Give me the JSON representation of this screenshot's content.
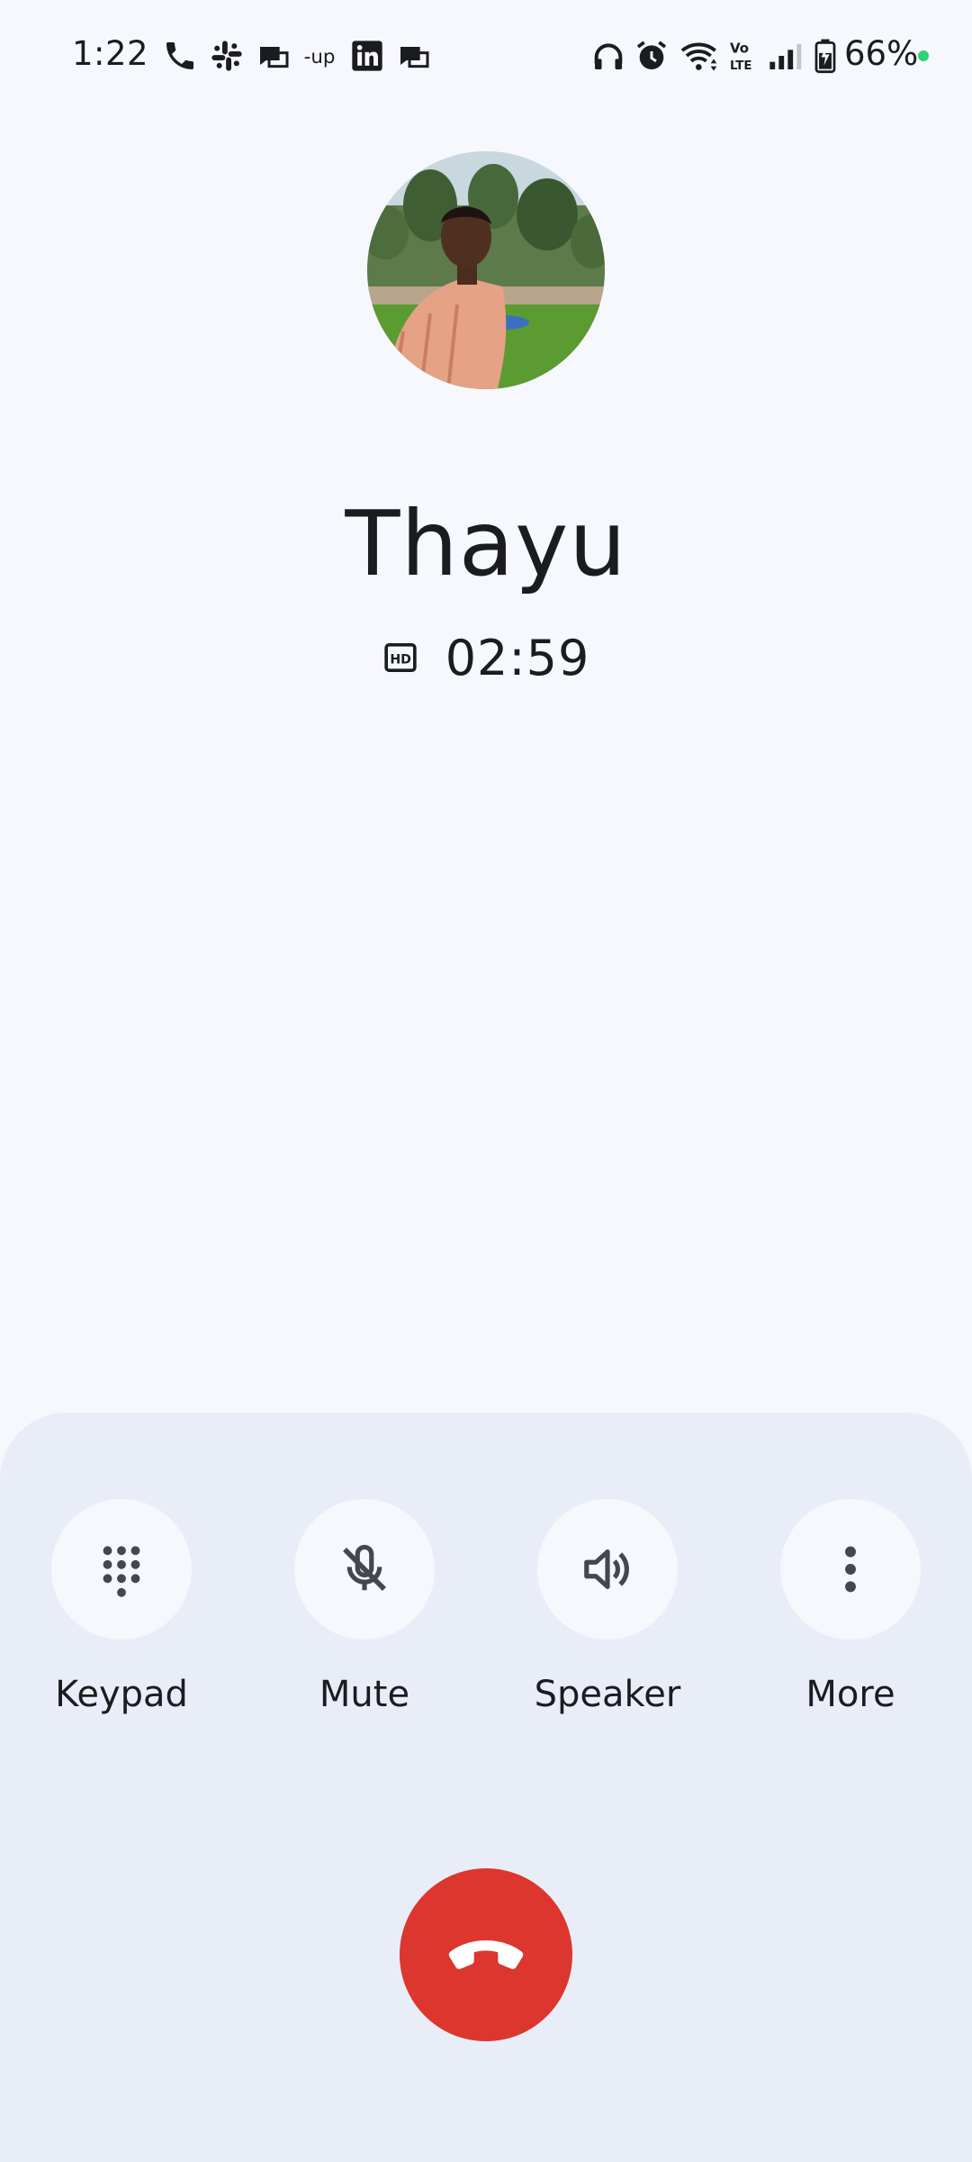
{
  "status_bar": {
    "time": "1:22",
    "battery_percent": "66%",
    "notification_icons": [
      "phone-icon",
      "slack-icon",
      "message-icon",
      "upwork-icon",
      "linkedin-icon",
      "message-icon"
    ],
    "system_icons": [
      "headphones-icon",
      "alarm-icon",
      "wifi-icon",
      "volte-icon",
      "signal-icon",
      "battery-charging-icon"
    ]
  },
  "call": {
    "contact_name": "Thayu",
    "duration": "02:59",
    "hd_badge": "HD"
  },
  "controls": [
    {
      "label": "Keypad",
      "icon": "dialpad-icon"
    },
    {
      "label": "Mute",
      "icon": "mic-off-icon"
    },
    {
      "label": "Speaker",
      "icon": "speaker-icon"
    },
    {
      "label": "More",
      "icon": "more-vert-icon"
    }
  ],
  "end_call": {
    "icon": "call-end-icon"
  },
  "colors": {
    "background": "#f6f8fd",
    "panel": "#e9edf8",
    "end_call": "#dc362e",
    "text": "#1b1c1f",
    "status_dot": "#2dd36f"
  }
}
